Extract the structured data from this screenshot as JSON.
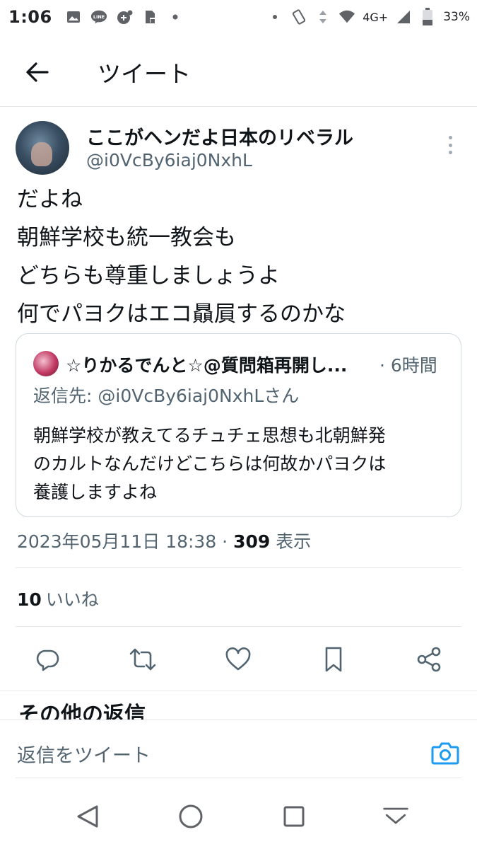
{
  "status_bar": {
    "time": "1:06",
    "network": "4G+",
    "battery": "33%"
  },
  "header": {
    "title": "ツイート"
  },
  "tweet": {
    "display_name": "ここがヘンだよ日本のリベラル",
    "handle": "@i0VcBy6iaj0NxhL",
    "text_lines": [
      "だよね",
      "朝鮮学校も統一教会も",
      "どちらも尊重しましょうよ",
      "何でパヨクはエコ贔屓するのかな"
    ],
    "quote": {
      "name": "☆りかるでんと☆@質問箱再開し...",
      "time": "· 6時間",
      "reply_to": "返信先: @i0VcBy6iaj0NxhLさん",
      "text_lines": [
        "朝鮮学校が教えてるチュチェ思想も北朝鮮発",
        "のカルトなんだけどこちらは何故かパヨクは",
        "養護しますよね"
      ]
    },
    "date": "2023年05月11日 18:38 · ",
    "views_count": "309",
    "views_label": " 表示",
    "likes_count": "10",
    "likes_label": "いいね"
  },
  "more_replies_label": "その他の返信",
  "composer": {
    "placeholder": "返信をツイート"
  },
  "colors": {
    "accent": "#1d9bf0",
    "secondary_text": "#536471",
    "border": "#cfd9de"
  },
  "icons": {
    "actions": [
      "reply-icon",
      "retweet-icon",
      "like-icon",
      "bookmark-icon",
      "share-icon"
    ],
    "nav": [
      "back-triangle-icon",
      "home-circle-icon",
      "recents-square-icon",
      "keyboard-hide-icon"
    ]
  }
}
